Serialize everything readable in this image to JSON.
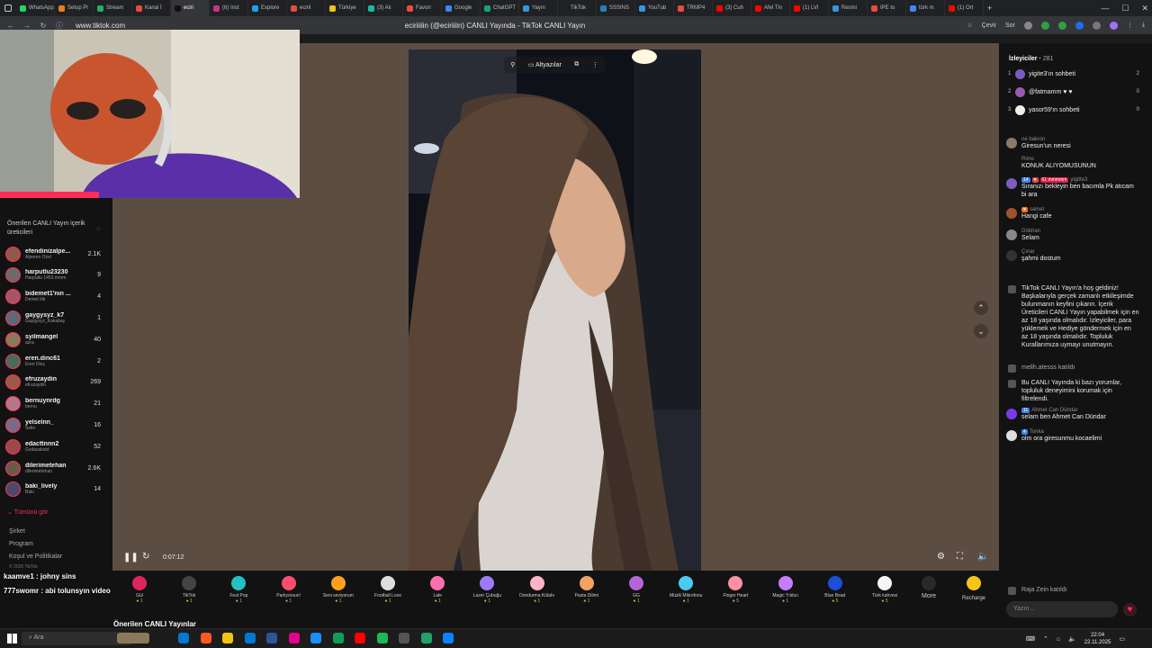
{
  "browser": {
    "tabs": [
      {
        "label": "WhatsApp",
        "color": "#25d366",
        "active": false
      },
      {
        "label": "Setup Pl",
        "color": "#e67e22",
        "active": false
      },
      {
        "label": "Stream",
        "color": "#27ae60",
        "active": false
      },
      {
        "label": "Kanal İ",
        "color": "#e74c3c",
        "active": false
      },
      {
        "label": "eciri",
        "color": "#111111",
        "active": true
      },
      {
        "label": "(6) Inst",
        "color": "#c13584",
        "active": false
      },
      {
        "label": "Explore",
        "color": "#1da1f2",
        "active": false
      },
      {
        "label": "ecirii",
        "color": "#e74c3c",
        "active": false
      },
      {
        "label": "Türkiye",
        "color": "#f1c40f",
        "active": false
      },
      {
        "label": "(3) Alı",
        "color": "#1abc9c",
        "active": false
      },
      {
        "label": "Favori",
        "color": "#e74c3c",
        "active": false
      },
      {
        "label": "Google",
        "color": "#4285f4",
        "active": false
      },
      {
        "label": "ChatGPT",
        "color": "#10a37f",
        "active": false
      },
      {
        "label": "Yayın",
        "color": "#3498db",
        "active": false
      },
      {
        "label": "TikTok",
        "color": "#222222",
        "active": false
      },
      {
        "label": "SSSINS",
        "color": "#2980b9",
        "active": false
      },
      {
        "label": "YouTub",
        "color": "#3498db",
        "active": false
      },
      {
        "label": "TRMP4",
        "color": "#e74c3c",
        "active": false
      },
      {
        "label": "(3) Cuh",
        "color": "#ff0000",
        "active": false
      },
      {
        "label": "Afel Tin",
        "color": "#ff0000",
        "active": false
      },
      {
        "label": "(1) LVI",
        "color": "#ff0000",
        "active": false
      },
      {
        "label": "Resmi",
        "color": "#3498db",
        "active": false
      },
      {
        "label": "IPE to",
        "color": "#e74c3c",
        "active": false
      },
      {
        "label": "türk m",
        "color": "#4285f4",
        "active": false
      },
      {
        "label": "(1) Ort",
        "color": "#ff0000",
        "active": false
      }
    ],
    "new_tab": "+",
    "window_controls": {
      "min": "—",
      "max": "☐",
      "close": "✕"
    },
    "url": "www.tiktok.com",
    "page_title": "eciriiiiin (@eciriiiin) CANLI Yayında - TikTok CANLI Yayın",
    "translate_label": "Çevir",
    "sor_label": "Sor"
  },
  "sidebar": {
    "heading": "Önerilen CANLI Yayın içerik üreticileri",
    "creators": [
      {
        "name": "efendinizalpe...",
        "sub": "Alperen Özel",
        "count": "2.1K",
        "color": "#8e5a4a"
      },
      {
        "name": "harputlu23230",
        "sub": "Harputlu 1453.mmm",
        "count": "9",
        "color": "#6b6b6b"
      },
      {
        "name": "bidemet1'nın ...",
        "sub": "Demet İlik",
        "count": "4",
        "color": "#a3566a"
      },
      {
        "name": "gaygysyz_k7",
        "sub": "Gaygysyz_Kakabay",
        "count": "1",
        "color": "#5a6a7a"
      },
      {
        "name": "syilmangel",
        "sub": "azra",
        "count": "40",
        "color": "#8a7a5a"
      },
      {
        "name": "eren.dinc61",
        "sub": "Eren Dinç",
        "count": "2",
        "color": "#4a6a5a"
      },
      {
        "name": "efruzaydin",
        "sub": "efruzaydin",
        "count": "269",
        "color": "#9a5a4a"
      },
      {
        "name": "bernuynrdg",
        "sub": "bernu",
        "count": "21",
        "color": "#b07a8a"
      },
      {
        "name": "yelselnn_",
        "sub": "Selin",
        "count": "16",
        "color": "#7a6a8a"
      },
      {
        "name": "edacttnnn2",
        "sub": "Gvdasakstd",
        "count": "52",
        "color": "#9a4a4a"
      },
      {
        "name": "dilerimetehan",
        "sub": "dilerimetehan",
        "count": "2.6K",
        "color": "#6a5a4a"
      },
      {
        "name": "baki_lively",
        "sub": "Baki",
        "count": "14",
        "color": "#4a4a6a"
      }
    ],
    "see_all": "Tümünü gör",
    "links": [
      "Şirket",
      "Program",
      "Koşul ve Politikalar"
    ],
    "copyright": "© 2025 TikTok"
  },
  "overlay_chat": [
    {
      "user": "kaamve1",
      "text": "johny sins"
    },
    {
      "user": "777swomr",
      "text": "abi tolunsyın video aç izleyek siktir et bunları yaa"
    }
  ],
  "player": {
    "toolbar_subtitles": "Altyazılar",
    "timecode": "0:07:12",
    "below_title": "Önerilen CANLI Yayınlar"
  },
  "gifts": [
    {
      "name": "Gül",
      "price": "1",
      "color": "#e0245e"
    },
    {
      "name": "TikTok",
      "price": "1",
      "color": "#444444"
    },
    {
      "name": "Fest Pop",
      "price": "1",
      "color": "#22c1c3"
    },
    {
      "name": "Parlıyorsun!",
      "price": "1",
      "color": "#ff4d6d"
    },
    {
      "name": "Seni seviyorum",
      "price": "1",
      "color": "#ff9f1c"
    },
    {
      "name": "Football Love",
      "price": "1",
      "color": "#dddddd"
    },
    {
      "name": "Lale",
      "price": "1",
      "color": "#ff6fae"
    },
    {
      "name": "Lazer Çubuğu",
      "price": "1",
      "color": "#9d7bff"
    },
    {
      "name": "Dondurma Külahı",
      "price": "1",
      "color": "#ffb3c6"
    },
    {
      "name": "Pasta Dilimi",
      "price": "1",
      "color": "#f4a261"
    },
    {
      "name": "GG",
      "price": "1",
      "color": "#b565d9"
    },
    {
      "name": "Müzik Mikrofonu",
      "price": "1",
      "color": "#4cc9f0"
    },
    {
      "name": "Finger Heart",
      "price": "5",
      "color": "#ff8fa3"
    },
    {
      "name": "Magic Yıldızı",
      "price": "1",
      "color": "#c77dff"
    },
    {
      "name": "Blue Bead",
      "price": "5",
      "color": "#1d4ed8"
    },
    {
      "name": "Türk kahvesi",
      "price": "5",
      "color": "#f5f5f5"
    }
  ],
  "gift_more": "More",
  "recharge": "Recharge",
  "chat": {
    "viewers_label": "İzleyiciler",
    "viewers_count": "281",
    "top_viewers": [
      {
        "rank": "1",
        "name": "yigite3'ın sohbeti",
        "count": "2",
        "color": "#7c5cbf"
      },
      {
        "rank": "2",
        "name": "@fatmamm ♥ ♥",
        "count": "0",
        "color": "#9b59b6"
      },
      {
        "rank": "3",
        "name": "yasor59'ın sohbeti",
        "count": "0",
        "color": "#eeeeee"
      }
    ],
    "messages": [
      {
        "user": "ne bakıon",
        "text": "Giresun'un neresi",
        "badges": [],
        "color": "#8a7a6a"
      },
      {
        "user": "Rimo",
        "text": "KONUK ALIYOMUSUNUN",
        "badges": [],
        "color": "#111111"
      },
      {
        "user": "yigitte3",
        "text": "Sıranızı bekleyin ben bacımla Pk atıcam bi ara",
        "badges": [
          {
            "t": "14",
            "c": "#3b82f6"
          },
          {
            "t": "♥",
            "c": "#ef4444"
          },
          {
            "t": "61 mmmmm",
            "c": "#e11d48"
          }
        ],
        "color": "#7c5cbf"
      },
      {
        "user": "samet",
        "text": "Hangi cafe",
        "badges": [
          {
            "t": "♥",
            "c": "#f97316"
          }
        ],
        "color": "#a0522d"
      },
      {
        "user": "Gökhan",
        "text": "Selam",
        "badges": [],
        "color": "#888888"
      },
      {
        "user": "Çınar",
        "text": "şahmi dostum",
        "badges": [],
        "color": "#333333"
      }
    ],
    "welcome": "TikTok CANLI Yayın'a hoş geldiniz! Başkalarıyla gerçek zamanlı etkileşimde bulunmanın keyfini çıkarın. İçerik Üreticileri CANLI Yayın yapabilmek için en az 18 yaşında olmalıdır. İzleyiciler, para yüklemek ve Hediye göndermek için en az 18 yaşında olmalıdır. Topluluk Kurallarımıza uymayı unutmayın.",
    "join1": "melih.atesss  katıldı",
    "filter_notice": "Bu CANLI Yayında ki bazı yorumlar, topluluk deneyimini korumak için filtrelendi.",
    "messages2": [
      {
        "user": "Ahmet Can Dündar",
        "text": "selam ben Ahmet Can Dündar",
        "badges": [
          {
            "t": "11",
            "c": "#3b82f6"
          }
        ],
        "color": "#7c3aed"
      },
      {
        "user": "Tonka",
        "text": "olm ora giresunmu kocaelimi",
        "badges": [
          {
            "t": "4",
            "c": "#3b82f6"
          }
        ],
        "color": "#dddddd"
      }
    ],
    "join2": "Raja Zein  katıldı",
    "input_placeholder": "Yazın..."
  },
  "taskbar": {
    "search_placeholder": "Ara",
    "icons": [
      "#0078d4",
      "#ff5722",
      "#f1c40f",
      "#0078d4",
      "#2b579a",
      "#e3008c",
      "#1b8fff",
      "#0f9d58",
      "#ff0000",
      "#1db954",
      "#555555",
      "#21a366",
      "#0b84ff"
    ],
    "time": "22:04",
    "date": "22.11.2025"
  }
}
